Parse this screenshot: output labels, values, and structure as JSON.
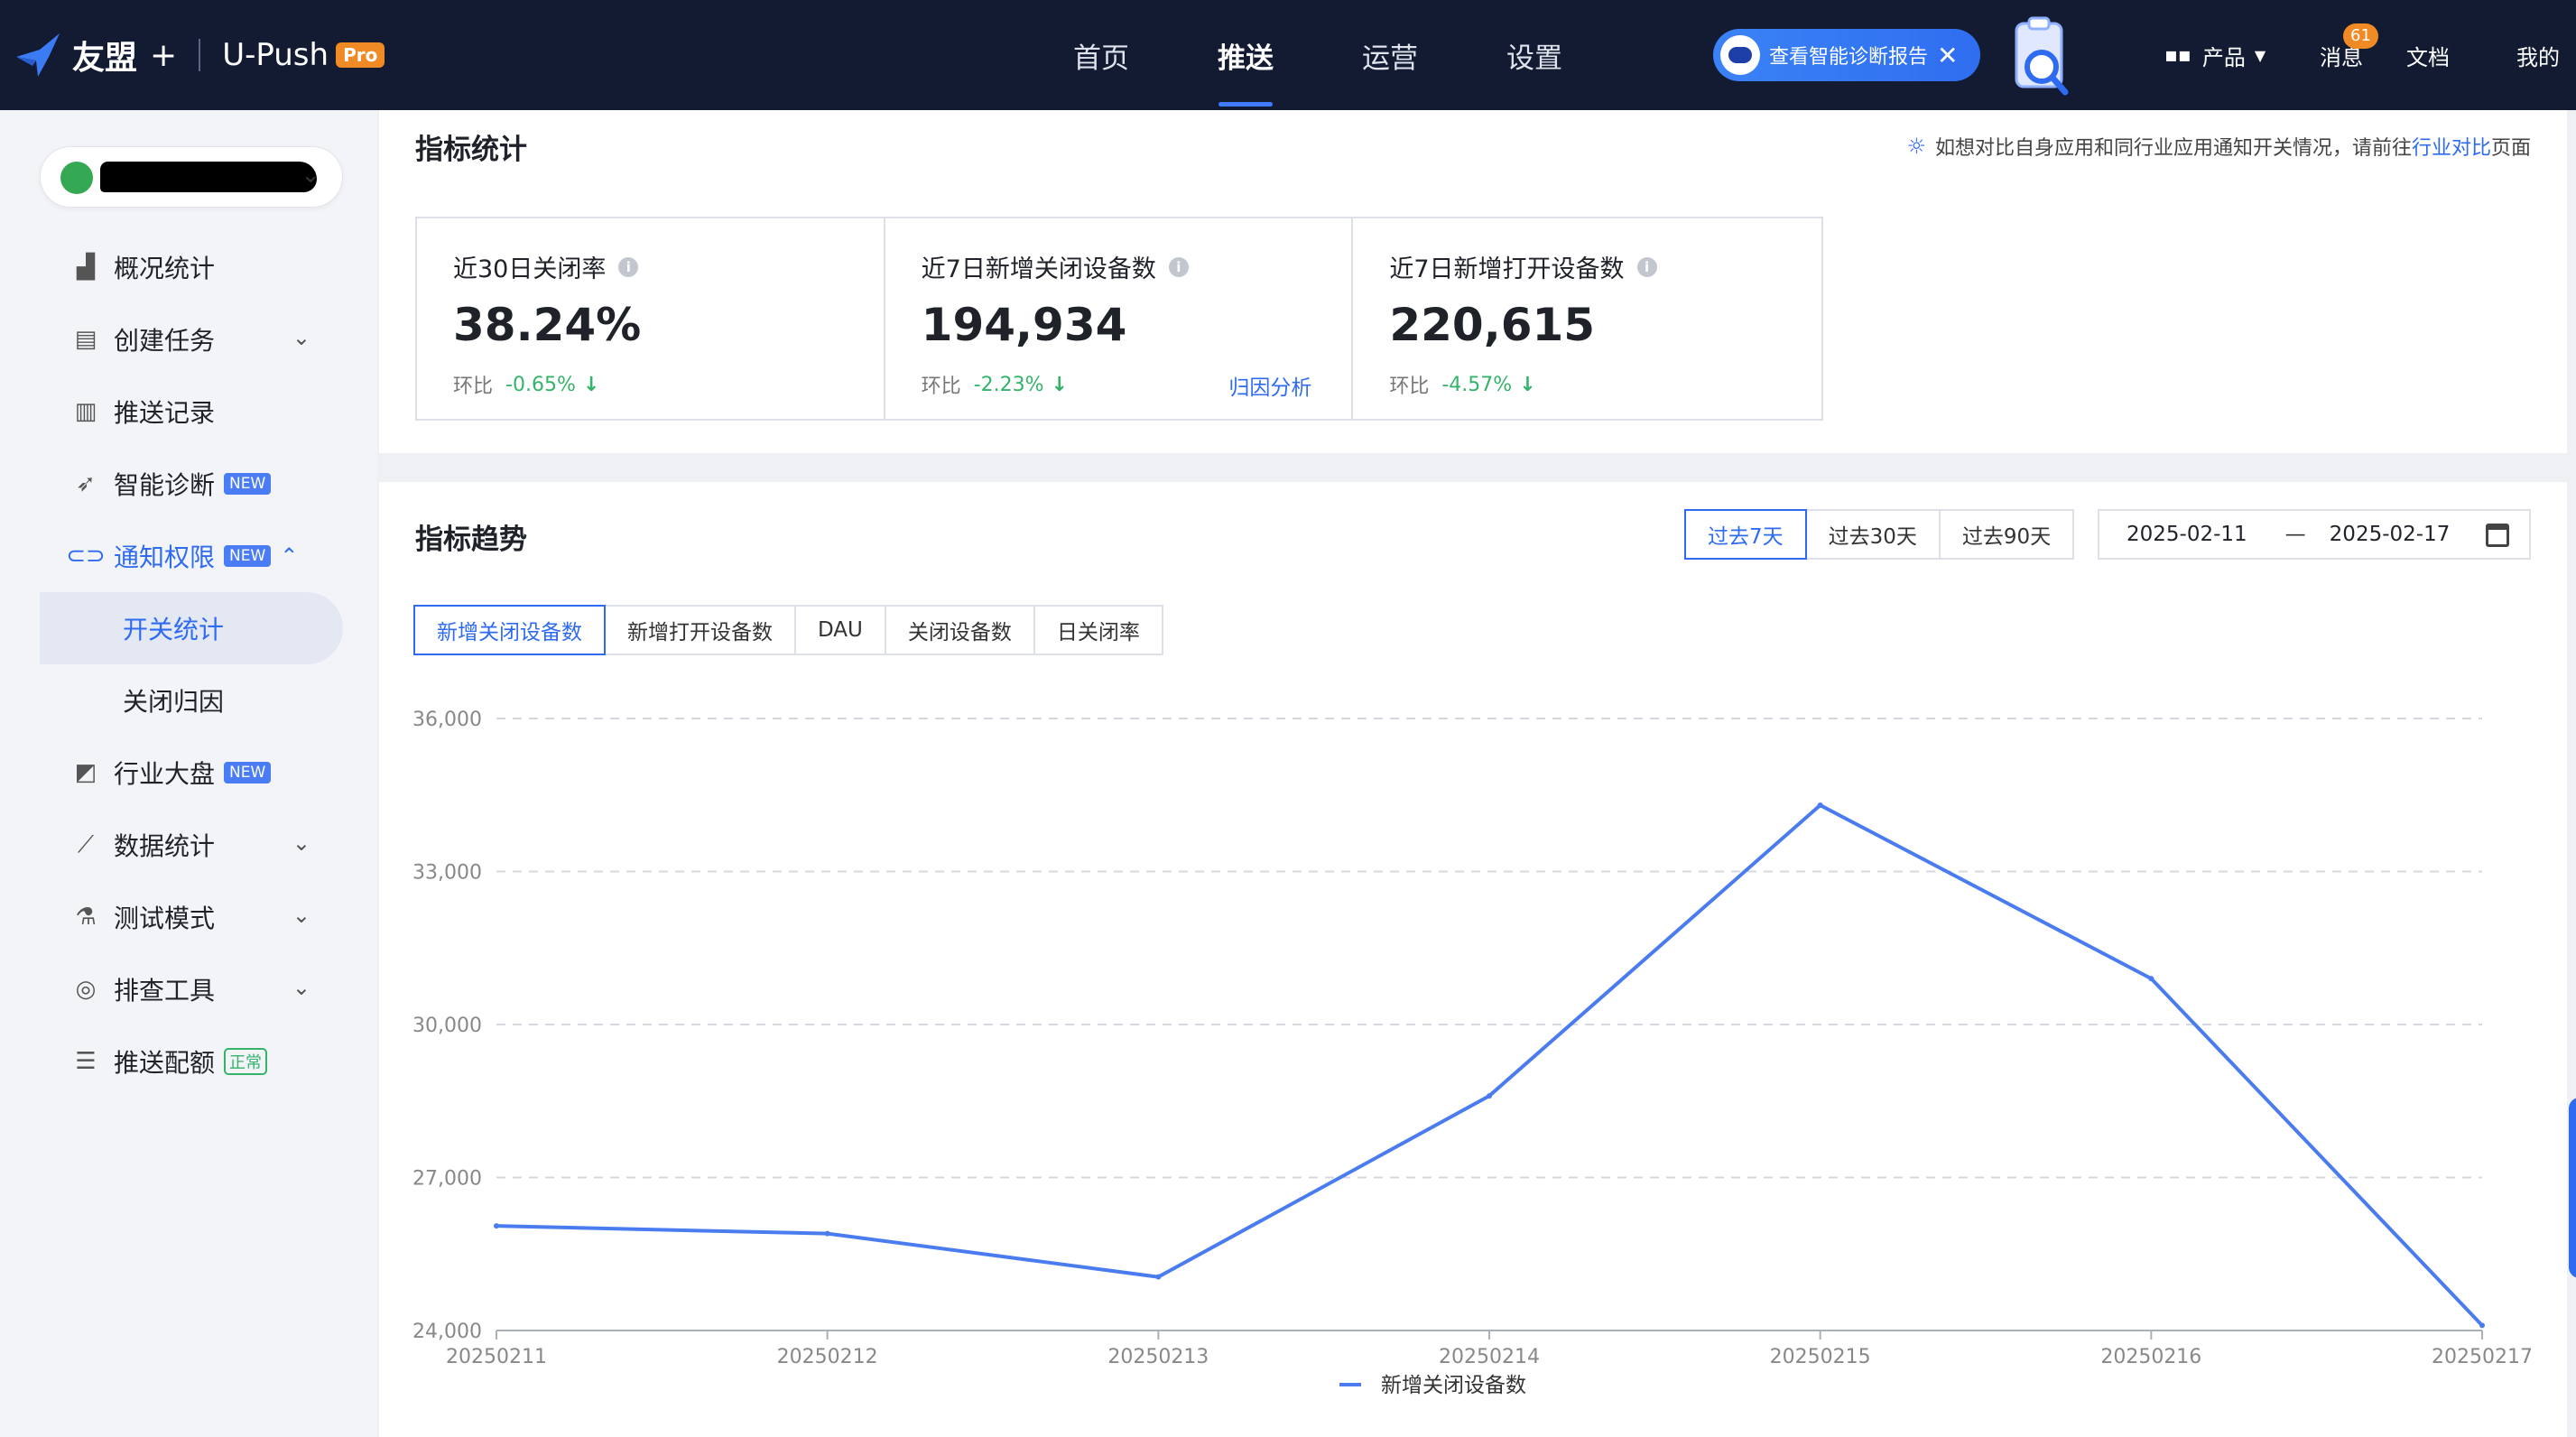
{
  "topbar": {
    "brand": "友盟",
    "plus": "+",
    "product": "U-Push",
    "pro_badge": "Pro",
    "nav": [
      "首页",
      "推送",
      "运营",
      "设置"
    ],
    "active_nav": "推送",
    "diag_pill": "查看智能诊断报告",
    "products": "产品",
    "messages": "消息",
    "messages_count": "61",
    "docs": "文档",
    "mine": "我的"
  },
  "sidebar": {
    "items": [
      {
        "label": "概况统计",
        "icon": "bar-chart-icon"
      },
      {
        "label": "创建任务",
        "icon": "task-icon",
        "arrow": "⌄"
      },
      {
        "label": "推送记录",
        "icon": "record-icon"
      },
      {
        "label": "智能诊断",
        "icon": "diagnose-icon",
        "badge": "NEW"
      },
      {
        "label": "通知权限",
        "icon": "toggle-icon",
        "badge": "NEW",
        "arrow": "⌃"
      },
      {
        "label": "开关统计",
        "sub": true
      },
      {
        "label": "关闭归因",
        "sub": true
      },
      {
        "label": "行业大盘",
        "icon": "market-icon",
        "badge": "NEW"
      },
      {
        "label": "数据统计",
        "icon": "line-chart-icon",
        "arrow": "⌄"
      },
      {
        "label": "测试模式",
        "icon": "flask-icon",
        "arrow": "⌄"
      },
      {
        "label": "排查工具",
        "icon": "target-icon",
        "arrow": "⌄"
      },
      {
        "label": "推送配额",
        "icon": "sliders-icon",
        "status": "正常"
      }
    ]
  },
  "metrics": {
    "title": "指标统计",
    "hint_prefix": "如想对比自身应用和同行业应用通知开关情况，请前往",
    "hint_link": "行业对比",
    "hint_suffix": "页面",
    "cards": [
      {
        "label": "近30日关闭率",
        "value": "38.24%",
        "cmp_label": "环比",
        "cmp_value": "-0.65%"
      },
      {
        "label": "近7日新增关闭设备数",
        "value": "194,934",
        "cmp_label": "环比",
        "cmp_value": "-2.23%",
        "link": "归因分析"
      },
      {
        "label": "近7日新增打开设备数",
        "value": "220,615",
        "cmp_label": "环比",
        "cmp_value": "-4.57%"
      }
    ]
  },
  "trend": {
    "title": "指标趋势",
    "ranges": [
      "过去7天",
      "过去30天",
      "过去90天"
    ],
    "active_range": "过去7天",
    "date_start": "2025-02-11",
    "date_sep": "—",
    "date_end": "2025-02-17",
    "tabs": [
      "新增关闭设备数",
      "新增打开设备数",
      "DAU",
      "关闭设备数",
      "日关闭率"
    ],
    "active_tab": "新增关闭设备数"
  },
  "chart_data": {
    "type": "line",
    "x": [
      "20250211",
      "20250212",
      "20250213",
      "20250214",
      "20250215",
      "20250216",
      "20250217"
    ],
    "series": [
      {
        "name": "新增关闭设备数",
        "values": [
          26050,
          25900,
          25050,
          28600,
          34300,
          30900,
          24100
        ],
        "color": "#4a7cf0"
      }
    ],
    "ylim": [
      24000,
      36000
    ],
    "yticks": [
      "24,000",
      "27,000",
      "30,000",
      "33,000",
      "36,000"
    ],
    "ytick_values": [
      24000,
      27000,
      30000,
      33000,
      36000
    ],
    "grid": true,
    "legend": "bottom-center"
  }
}
